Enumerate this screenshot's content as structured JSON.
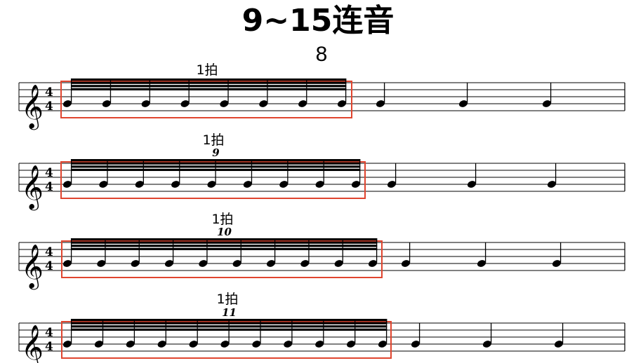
{
  "page": {
    "title": "9~15连音",
    "subtitle": "8"
  },
  "time_signature": {
    "top": "4",
    "bottom": "4"
  },
  "clef": "treble-clef-icon",
  "highlight_color": "#e0452f",
  "systems": [
    {
      "beat_label": "1拍",
      "tuplet_number": "",
      "group_notes": 8,
      "trailing_quarters": 3
    },
    {
      "beat_label": "1拍",
      "tuplet_number": "9",
      "group_notes": 9,
      "trailing_quarters": 3
    },
    {
      "beat_label": "1拍",
      "tuplet_number": "10",
      "group_notes": 10,
      "trailing_quarters": 3
    },
    {
      "beat_label": "1拍",
      "tuplet_number": "11",
      "group_notes": 11,
      "trailing_quarters": 3
    }
  ]
}
